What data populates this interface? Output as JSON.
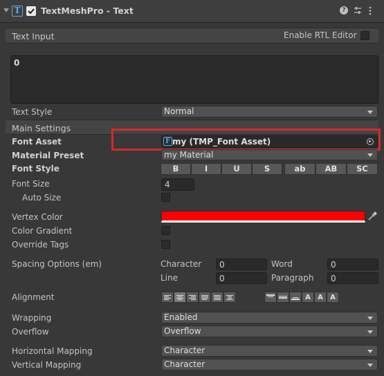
{
  "header": {
    "title": "TextMeshPro - Text",
    "component_icon": "T",
    "enabled_checkbox": "checked",
    "help_icon": "help-icon",
    "presets_icon": "sliders-icon",
    "menu_icon": "kebab-menu-icon"
  },
  "text_input": {
    "section_label": "Text Input",
    "rtl_label": "Enable RTL Editor",
    "text_value": "0",
    "text_style_label": "Text Style",
    "text_style_value": "Normal"
  },
  "main_settings": {
    "section_label": "Main Settings",
    "font_asset_label": "Font Asset",
    "font_asset_icon": "F",
    "font_asset_value": "my (TMP_Font Asset)",
    "material_preset_label": "Material Preset",
    "material_preset_value": "my Material",
    "font_style_label": "Font Style",
    "font_style_buttons": [
      "B",
      "I",
      "U",
      "S",
      "ab",
      "AB",
      "SC"
    ],
    "font_size_label": "Font Size",
    "font_size_value": "4",
    "auto_size_label": "Auto Size",
    "vertex_color_label": "Vertex Color",
    "vertex_color": "#ff0000",
    "color_gradient_label": "Color Gradient",
    "override_tags_label": "Override Tags",
    "spacing_label": "Spacing Options (em)",
    "spacing": {
      "character_label": "Character",
      "character_value": "0",
      "word_label": "Word",
      "word_value": "0",
      "line_label": "Line",
      "line_value": "0",
      "paragraph_label": "Paragraph",
      "paragraph_value": "0"
    },
    "alignment_label": "Alignment",
    "wrapping_label": "Wrapping",
    "wrapping_value": "Enabled",
    "overflow_label": "Overflow",
    "overflow_value": "Overflow",
    "horizontal_mapping_label": "Horizontal Mapping",
    "horizontal_mapping_value": "Character",
    "vertical_mapping_label": "Vertical Mapping",
    "vertical_mapping_value": "Character"
  },
  "colors": {
    "highlight_box": "#d6282e",
    "vertex_color": "#ff0000"
  }
}
